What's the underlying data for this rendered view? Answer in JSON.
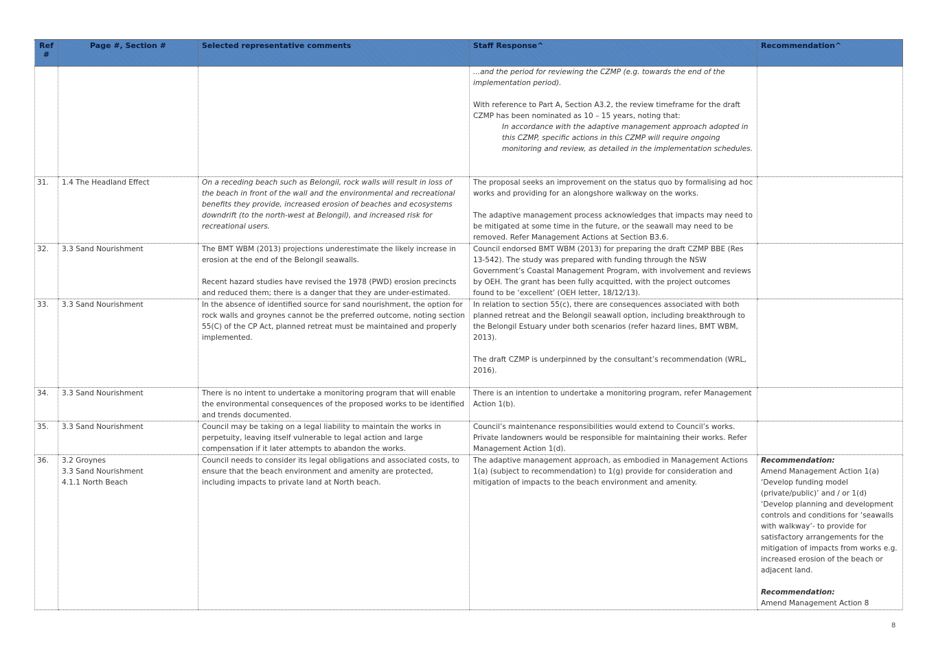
{
  "table": {
    "headers": [
      "Ref #",
      "Page #, Section #",
      "Selected representative comments",
      "Staff Response^",
      "Recommendation^"
    ],
    "continuation": {
      "staff_1": "...and the period for reviewing the CZMP (e.g. towards the end of the implementation period).",
      "staff_2": "With reference to Part A, Section A3.2, the review timeframe for the draft CZMP has been nominated as 10 – 15 years, noting that:",
      "staff_3": "In accordance with the adaptive management approach adopted in this CZMP, specific actions in this CZMP will require ongoing monitoring and review, as detailed in the implementation schedules."
    },
    "rows": [
      {
        "ref": "31.",
        "section": [
          "1.4 The Headland Effect"
        ],
        "comment": [
          "On a receding beach such as Belongil, rock walls will result in loss of the beach in front of the wall and the environmental and recreational benefits they provide, increased erosion of beaches and ecosystems downdrift (to the north-west at Belongil), and increased risk for recreational users."
        ],
        "response": [
          "The proposal seeks an improvement on the status quo by formalising ad hoc works and providing for an alongshore walkway on the works.",
          "The adaptive management process acknowledges that impacts may need to be mitigated at some time in the future, or the seawall may need to be removed. Refer Management Actions at Section B3.6."
        ]
      },
      {
        "ref": "32.",
        "section": [
          "3.3 Sand Nourishment"
        ],
        "comment": [
          "The BMT WBM (2013) projections underestimate the likely increase in erosion at the end of the Belongil seawalls.",
          "Recent hazard studies have revised the 1978 (PWD) erosion precincts and reduced them; there is a danger that they are under-estimated."
        ],
        "response": [
          "Council endorsed BMT WBM (2013) for preparing the draft CZMP BBE (Res 13-542). The study was prepared with funding through the NSW Government’s Coastal Management Program, with involvement and reviews by OEH. The grant has been fully acquitted, with the project outcomes found to be ‘excellent’ (OEH letter, 18/12/13)."
        ]
      },
      {
        "ref": "33.",
        "section": [
          "3.3 Sand Nourishment"
        ],
        "comment": [
          "In the absence of identified source for sand nourishment, the option for rock walls and groynes cannot be the preferred outcome, noting section 55(C) of the CP Act, planned retreat must be maintained and properly implemented."
        ],
        "response": [
          "In relation to section 55(c), there are consequences associated with both planned retreat and the Belongil seawall option, including breakthrough to the Belongil Estuary under both scenarios (refer hazard lines, BMT WBM, 2013).",
          "The draft CZMP is underpinned by the consultant’s recommendation (WRL, 2016)."
        ]
      },
      {
        "ref": "34.",
        "section": [
          "3.3 Sand Nourishment"
        ],
        "comment": [
          "There is no intent to undertake a monitoring program that will enable the environmental consequences of the proposed works to be identified and trends documented."
        ],
        "response": [
          "There is an intention to undertake a monitoring program, refer Management Action 1(b)."
        ]
      },
      {
        "ref": "35.",
        "section": [
          "3.3 Sand Nourishment"
        ],
        "comment": [
          "Council may be taking on a legal liability to maintain the works in perpetuity, leaving itself vulnerable to legal action and large compensation if it later attempts to abandon the works."
        ],
        "response": [
          "Council’s maintenance responsibilities would extend to Council’s works. Private landowners would be responsible for maintaining their works. Refer Management Action 1(d)."
        ]
      },
      {
        "ref": "36.",
        "section": [
          "3.2 Groynes",
          "3.3 Sand Nourishment",
          "4.1.1 North Beach"
        ],
        "comment": [
          "Council needs to consider its legal obligations and associated costs, to ensure that the beach environment and amenity are protected, including impacts to private land at North beach."
        ],
        "response": [
          "The adaptive management approach, as embodied in Management Actions 1(a) (subject to recommendation) to 1(g) provide for consideration and mitigation of impacts to the beach environment and amenity."
        ],
        "recommendation": {
          "heading_1": "Recommendation:",
          "text_1": "Amend Management Action 1(a) ‘Develop funding model (private/public)’ and / or 1(d) ‘Develop planning and development controls and conditions for ‘seawalls with walkway’- to provide for satisfactory arrangements for the mitigation of impacts from works e.g. increased erosion of the beach or adjacent land.",
          "heading_2": "Recommendation:",
          "text_2": "Amend Management Action 8"
        }
      }
    ]
  },
  "page_number": "8"
}
